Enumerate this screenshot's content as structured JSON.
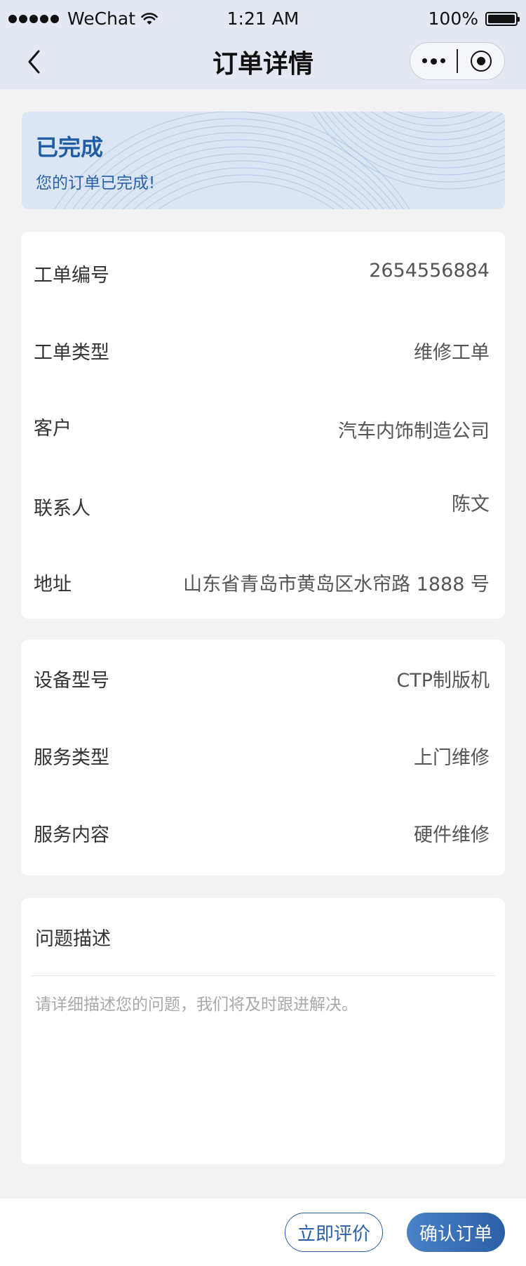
{
  "status_bar": {
    "carrier": "WeChat",
    "time": "1:21 AM",
    "battery": "100%"
  },
  "nav": {
    "title": "订单详情"
  },
  "banner": {
    "status": "已完成",
    "message": "您的订单已完成!"
  },
  "order_info": [
    {
      "label": "工单编号",
      "value": "2654556884"
    },
    {
      "label": "工单类型",
      "value": "维修工单"
    },
    {
      "label": "客户",
      "value": "汽车内饰制造公司"
    },
    {
      "label": "联系人",
      "value": "陈文"
    },
    {
      "label": "地址",
      "value": "山东省青岛市黄岛区水帘路 1888 号"
    }
  ],
  "service_info": [
    {
      "label": "设备型号",
      "value": "CTP制版机"
    },
    {
      "label": "服务类型",
      "value": "上门维修"
    },
    {
      "label": "服务内容",
      "value": "硬件维修"
    }
  ],
  "problem": {
    "title": "问题描述",
    "placeholder": "请详细描述您的问题，我们将及时跟进解决。"
  },
  "actions": {
    "evaluate_label": "立即评价",
    "confirm_label": "确认订单"
  },
  "colors": {
    "accent": "#2a5fa7",
    "banner_bg": "#dbe5f3",
    "topbar_bg": "#e3e8f2"
  }
}
